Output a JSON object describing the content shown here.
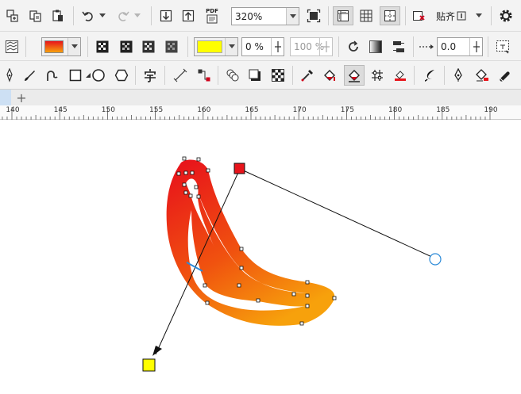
{
  "toolbar_main": {
    "zoom_value": "320%",
    "snap_label": "贴齐",
    "pdf_label": "PDF"
  },
  "property_bar": {
    "gradient_start_color": "#e8141b",
    "gradient_end_color": "#f7a10c",
    "fill_swatch_color": "#ffff00",
    "transparency_value": "0 %",
    "node_scale_value": "100 %",
    "acceleration_value": "0.0"
  },
  "tools": [
    "pick-tool-icon",
    "freehand-tool-icon",
    "bezier-tool-icon",
    "rectangle-tool-icon",
    "ellipse-tool-icon",
    "polygon-tool-icon",
    "text-tool-icon",
    "dimension-tool-icon",
    "connector-tool-icon",
    "blend-tool-icon",
    "drop-shadow-tool-icon",
    "transparency-tool-icon",
    "eyedropper-tool-icon",
    "interactive-fill-tool-icon",
    "mesh-fill-tool-icon",
    "smart-fill-tool-icon",
    "artistic-media-icon",
    "pen-nib-icon",
    "fill-bucket-icon",
    "eraser-icon"
  ],
  "tabs": {
    "add_label": "+"
  },
  "ruler": {
    "labels": [
      "140",
      "145",
      "150",
      "155",
      "160",
      "165",
      "170",
      "175",
      "180",
      "185",
      "190"
    ]
  }
}
